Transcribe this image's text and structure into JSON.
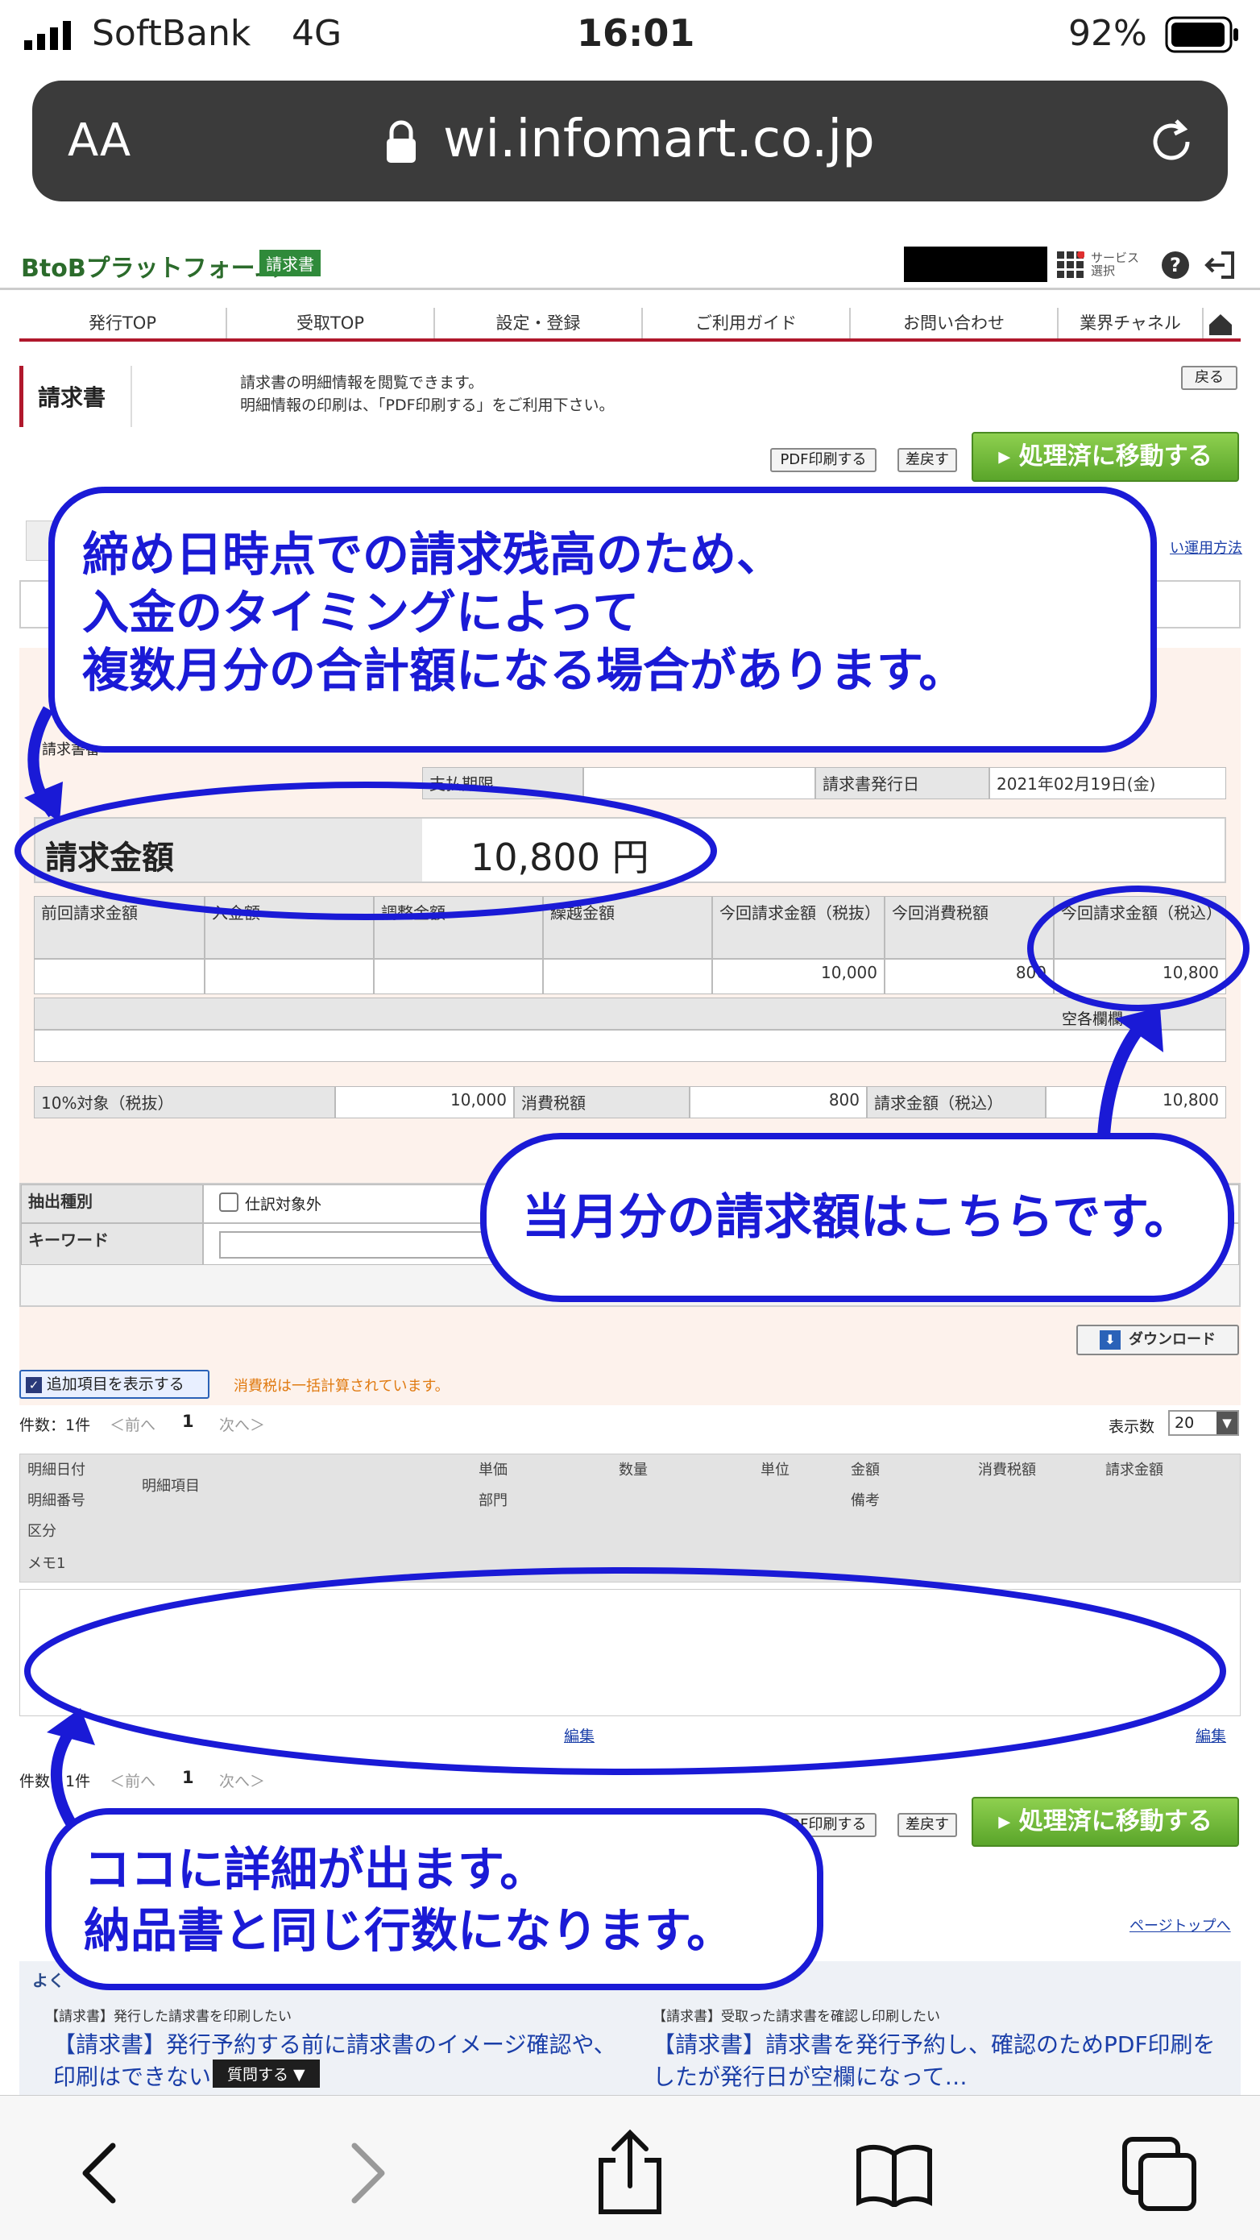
{
  "status": {
    "carrier": "SoftBank",
    "network": "4G",
    "time": "16:01",
    "battery": "92%"
  },
  "urlbar": {
    "text_size": "AA",
    "url": "wi.infomart.co.jp"
  },
  "site": {
    "logo": "BtoBプラットフォーム",
    "logo_badge": "請求書",
    "service_select": "サービス選択",
    "nav": [
      "発行TOP",
      "受取TOP",
      "設定・登録",
      "ご利用ガイド",
      "お問い合わせ",
      "業界チャネル"
    ],
    "page_title": "請求書",
    "desc1": "請求書の明細情報を閲覧できます。",
    "desc2": "明細情報の印刷は、「PDF印刷する」をご利用下さい。",
    "back": "戻る",
    "pdf_print": "PDF印刷する",
    "return": "差戻す",
    "move_processed": "処理済に移動する",
    "ops_link": "い運用方法",
    "issue_date_label": "請求書発行日",
    "issue_date": "2021年02月19日(金)",
    "payment_label": "支払期限",
    "invoice_no_label": "請求書番",
    "amount_label": "請求金額",
    "amount_value": "10,800 円",
    "summary_headers": [
      "前回請求金額",
      "入金額",
      "調整金額",
      "繰越金額",
      "今回請求金額（税抜）",
      "今回消費税額",
      "今回請求金額（税込）"
    ],
    "summary_values": [
      "",
      "",
      "",
      "",
      "10,000",
      "800",
      "10,800"
    ],
    "summary_blank_label": "空各欄欄",
    "tax_row": {
      "label1": "10%対象（税抜）",
      "val1": "10,000",
      "label2": "消費税額",
      "val2": "800",
      "label3": "請求金額（税込）",
      "val3": "10,800"
    },
    "filter": {
      "type_label": "抽出種別",
      "checkbox_label": "仕訳対象外",
      "keyword_label": "キーワード"
    },
    "download": "ダウンロード",
    "show_extra": "追加項目を表示する",
    "tax_note": "消費税は一括計算されています。",
    "count": "件数：1件",
    "prev": "＜前へ",
    "page": "1",
    "next": "次へ＞",
    "display_count_label": "表示数",
    "display_count": "20",
    "detail_headers_row1": [
      "明細日付",
      "明細項目",
      "単価",
      "数量",
      "単位",
      "金額",
      "消費税額",
      "請求金額"
    ],
    "detail_headers_row2": [
      "明細番号",
      "部門",
      "備考"
    ],
    "detail_headers_row3": "区分",
    "detail_headers_row4": "メモ1",
    "edit": "編集",
    "page_top": "ページトップへ",
    "faq1_tag": "【請求書】発行した請求書を印刷したい",
    "faq1_text": "【請求書】発行予約する前に請求書のイメージ確認や、印刷はできない",
    "faq2_tag": "【請求書】受取った請求書を確認し印刷したい",
    "faq2_text": "【請求書】請求書を発行予約し、確認のためPDF印刷をしたが発行日が空欄になって…",
    "question": "質問する ▼",
    "faq_head": "よく"
  },
  "callouts": {
    "top": [
      "締め日時点での請求残高のため、",
      "入金のタイミングによって",
      "複数月分の合計額になる場合があります。"
    ],
    "right": "当月分の請求額はこちらです。",
    "bottom": [
      "ココに詳細が出ます。",
      "納品書と同じ行数になります。"
    ]
  },
  "colors": {
    "annotation": "#1a1ad6",
    "green": "#6bb83a",
    "url_bg": "#3b3b3b"
  }
}
